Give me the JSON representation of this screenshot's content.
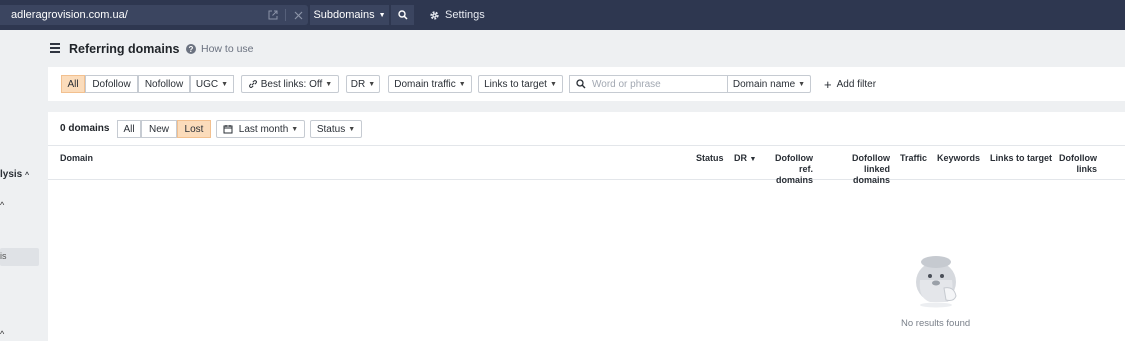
{
  "topbar": {
    "url": "adleragrovision.com.ua/",
    "mode": "Subdomains",
    "settings": "Settings"
  },
  "sidebar": {
    "section_label": "lysis",
    "active_item": "is"
  },
  "header": {
    "title": "Referring domains",
    "help": "How to use"
  },
  "filters": {
    "link_type": [
      "All",
      "Dofollow",
      "Nofollow",
      "UGC"
    ],
    "best_links": "Best links: Off",
    "dr": "DR",
    "domain_traffic": "Domain traffic",
    "links_to_target": "Links to target",
    "search_placeholder": "Word or phrase",
    "search_scope": "Domain name",
    "add_filter": "Add filter"
  },
  "table": {
    "count": "0 domains",
    "states": [
      "All",
      "New",
      "Lost"
    ],
    "period": "Last month",
    "status": "Status",
    "columns": {
      "domain": "Domain",
      "status": "Status",
      "dr": "DR",
      "dofollow_ref_1": "Dofollow ref.",
      "dofollow_ref_2": "domains",
      "dofollow_linked_1": "Dofollow linked",
      "dofollow_linked_2": "domains",
      "traffic": "Traffic",
      "keywords": "Keywords",
      "links_to_target": "Links to target",
      "dofollow_links_1": "Dofollow",
      "dofollow_links_2": "links"
    },
    "empty_message": "No results found"
  }
}
